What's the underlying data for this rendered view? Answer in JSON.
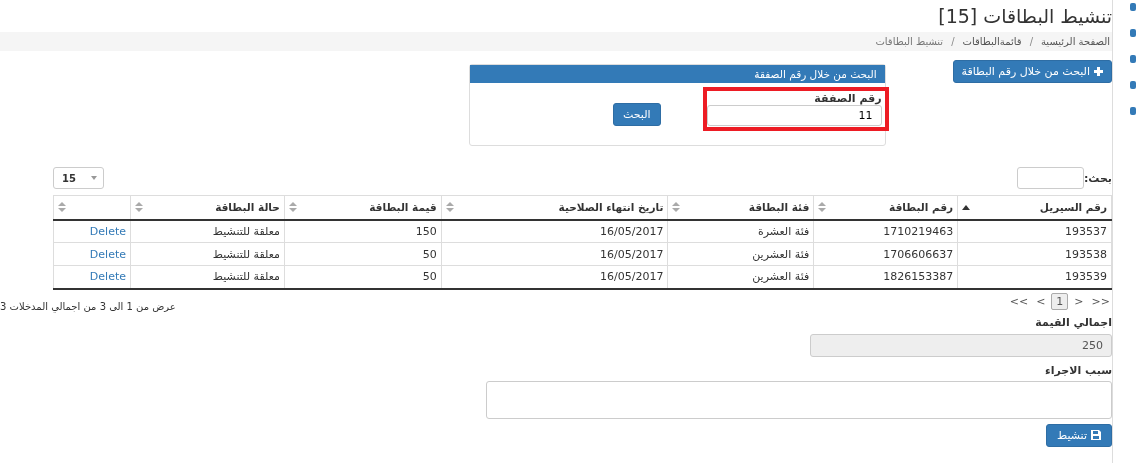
{
  "title": "تنشيط البطاقات [15]",
  "breadcrumb": {
    "separator": "/",
    "items": [
      {
        "label": "الصفحة الرئيسية",
        "current": false
      },
      {
        "label": "قائمةالبطاقات",
        "current": false
      },
      {
        "label": "تنشيط البطاقات",
        "current": true
      }
    ]
  },
  "add_button": {
    "label": "البحث من خلال رقم البطاقة"
  },
  "search_panel": {
    "title": "البحث من خلال رقم الصفقة",
    "field_label": "رقم الصفقة",
    "value": "11",
    "highlighted": true,
    "button": "البحث"
  },
  "table_controls": {
    "search_label": "بحث:",
    "page_length": "15"
  },
  "table": {
    "columns": [
      {
        "label": "رقم السيريل",
        "sorted_ascending": true
      },
      {
        "label": "رقم البطاقة",
        "sorted_ascending": false
      },
      {
        "label": "فئة البطاقة",
        "sorted_ascending": false
      },
      {
        "label": "تاريخ انتهاء الصلاحية",
        "sorted_ascending": false
      },
      {
        "label": "قيمة البطاقة",
        "sorted_ascending": false
      },
      {
        "label": "حالة البطاقة",
        "sorted_ascending": false
      },
      {
        "sorted_ascending": false
      }
    ],
    "rows": [
      {
        "cells": [
          "193537",
          "1710219463",
          "فئة العشرة",
          "16/05/2017",
          "150",
          "معلقة للتنشيط"
        ],
        "action": "Delete"
      },
      {
        "cells": [
          "193538",
          "1706606637",
          "فئة العشرين",
          "16/05/2017",
          "50",
          "معلقة للتنشيط"
        ],
        "action": "Delete"
      },
      {
        "cells": [
          "193539",
          "1826153387",
          "فئة العشرين",
          "16/05/2017",
          "50",
          "معلقة للتنشيط"
        ],
        "action": "Delete"
      }
    ]
  },
  "pagination": [
    {
      "label": ">>",
      "selected": false
    },
    {
      "label": ">",
      "selected": false
    },
    {
      "label": "1",
      "selected": true
    },
    {
      "label": "<",
      "selected": false
    },
    {
      "label": "<<",
      "selected": false
    }
  ],
  "info": "عرض من 1 الى 3 من اجمالي المدخلات 3",
  "total": {
    "label": "اجمالي القيمة",
    "value": "250",
    "disabled": true
  },
  "reason": {
    "label": "سبب الاجراء"
  },
  "submit": {
    "label": "تنشيط"
  }
}
